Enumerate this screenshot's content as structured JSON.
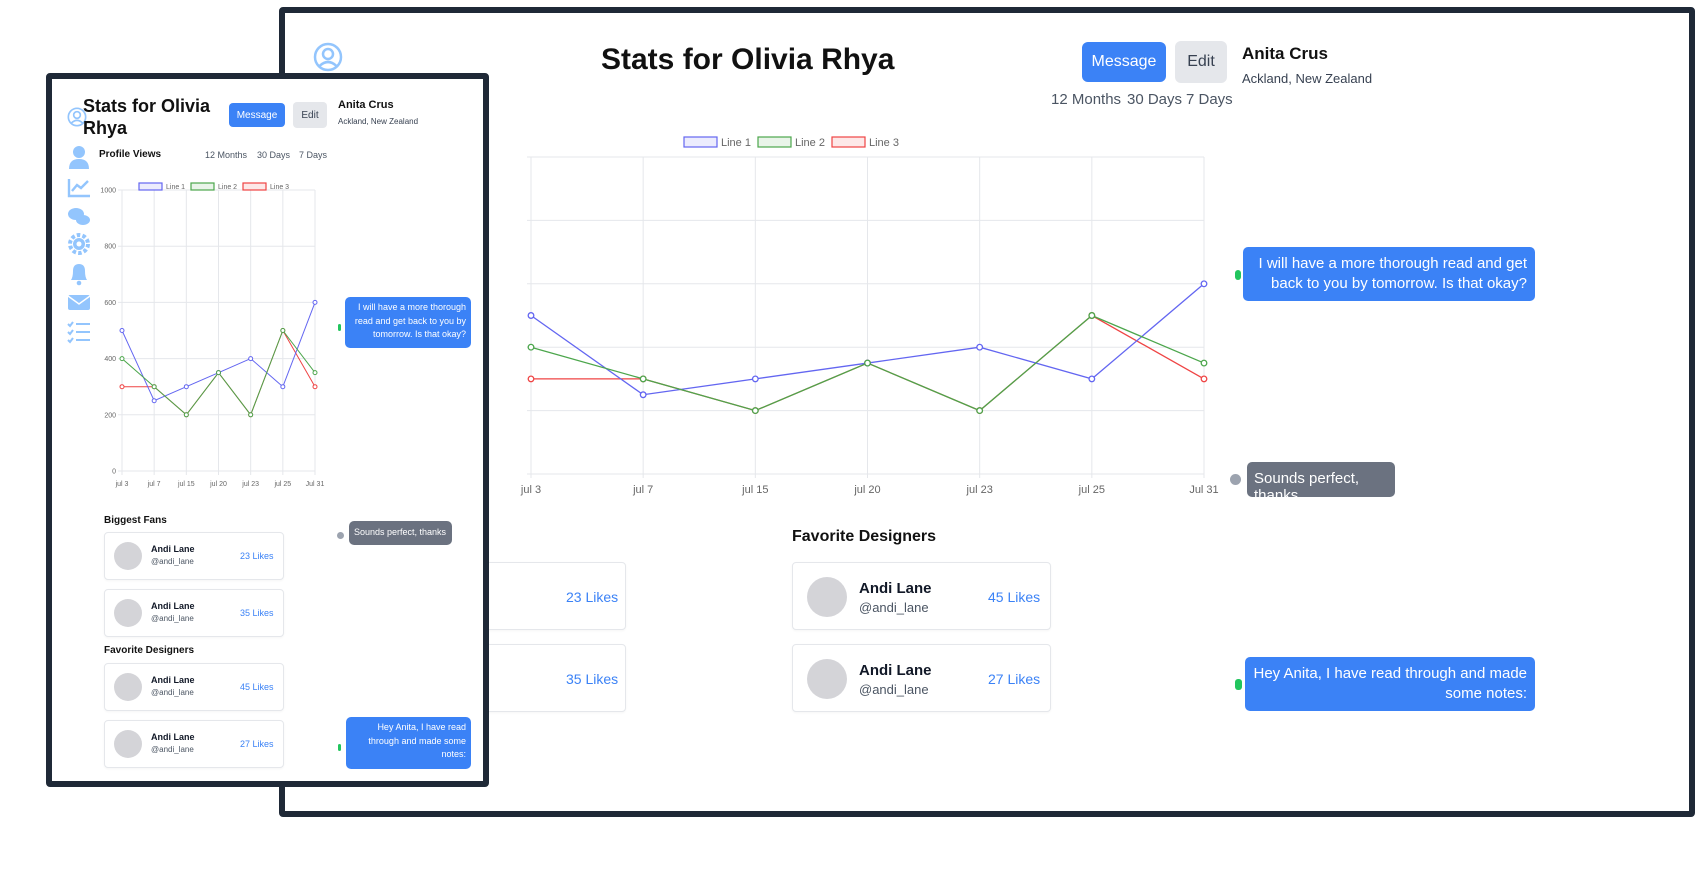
{
  "title": "Stats for Olivia Rhya",
  "title_line1": "Stats for Olivia",
  "title_line2": "Rhya",
  "actions": {
    "message_label": "Message",
    "edit_label": "Edit"
  },
  "user": {
    "name": "Anita Crus",
    "location": "Ackland, New Zealand"
  },
  "section_profile_views": "Profile Views",
  "ranges": [
    "12 Months",
    "30 Days",
    "7 Days"
  ],
  "legend": [
    "Line 1",
    "Line 2",
    "Line 3"
  ],
  "colors": {
    "accent": "#3b82f6",
    "line1": "#6366f1",
    "line2": "#4ca64c",
    "line3": "#ef4444",
    "frame": "#1f2937",
    "sidebar_icon": "#93c5fd"
  },
  "sidebar_icons": [
    "user-icon",
    "chart-icon",
    "chat-icon",
    "settings-icon",
    "bell-icon",
    "mail-icon",
    "checklist-icon"
  ],
  "chart_data": {
    "type": "line",
    "x": [
      "Jul 3",
      "Jul 7",
      "Jul 15",
      "Jul 20",
      "Jul 23",
      "Jul 25",
      "Jul 31"
    ],
    "x_tick_labels": [
      "jul 3",
      "jul 7",
      "jul 15",
      "jul 20",
      "jul 23",
      "jul 25",
      "Jul 31"
    ],
    "series": [
      {
        "name": "Line 1",
        "values": [
          500,
          250,
          300,
          350,
          400,
          300,
          600
        ]
      },
      {
        "name": "Line 2",
        "values": [
          400,
          300,
          200,
          350,
          200,
          500,
          350
        ]
      },
      {
        "name": "Line 3",
        "values": [
          300,
          300,
          200,
          350,
          200,
          500,
          300
        ]
      }
    ],
    "ylim": [
      0,
      1000
    ],
    "y_ticks": [
      0,
      200,
      400,
      600,
      800,
      1000
    ],
    "grid": true,
    "legend_position": "top-center"
  },
  "biggest_fans": {
    "title": "Biggest Fans",
    "items": [
      {
        "name": "Andi Lane",
        "handle": "@andi_lane",
        "likes": "23 Likes"
      },
      {
        "name": "Andi Lane",
        "handle": "@andi_lane",
        "likes": "35 Likes"
      }
    ]
  },
  "favorite_designers": {
    "title": "Favorite Designers",
    "items": [
      {
        "name": "Andi Lane",
        "handle": "@andi_lane",
        "likes": "45 Likes"
      },
      {
        "name": "Andi Lane",
        "handle": "@andi_lane",
        "likes": "27 Likes"
      }
    ]
  },
  "messages": [
    {
      "text": "I will have a more thorough read and get back to you by tomorrow. Is that okay?",
      "from": "other",
      "indicator": "#22c55e"
    },
    {
      "text": "Sounds perfect, thanks",
      "from": "me",
      "indicator": "#9ca3af"
    },
    {
      "text": "Hey Anita, I have read through and made some notes:",
      "from": "other",
      "indicator": "#22c55e"
    }
  ]
}
